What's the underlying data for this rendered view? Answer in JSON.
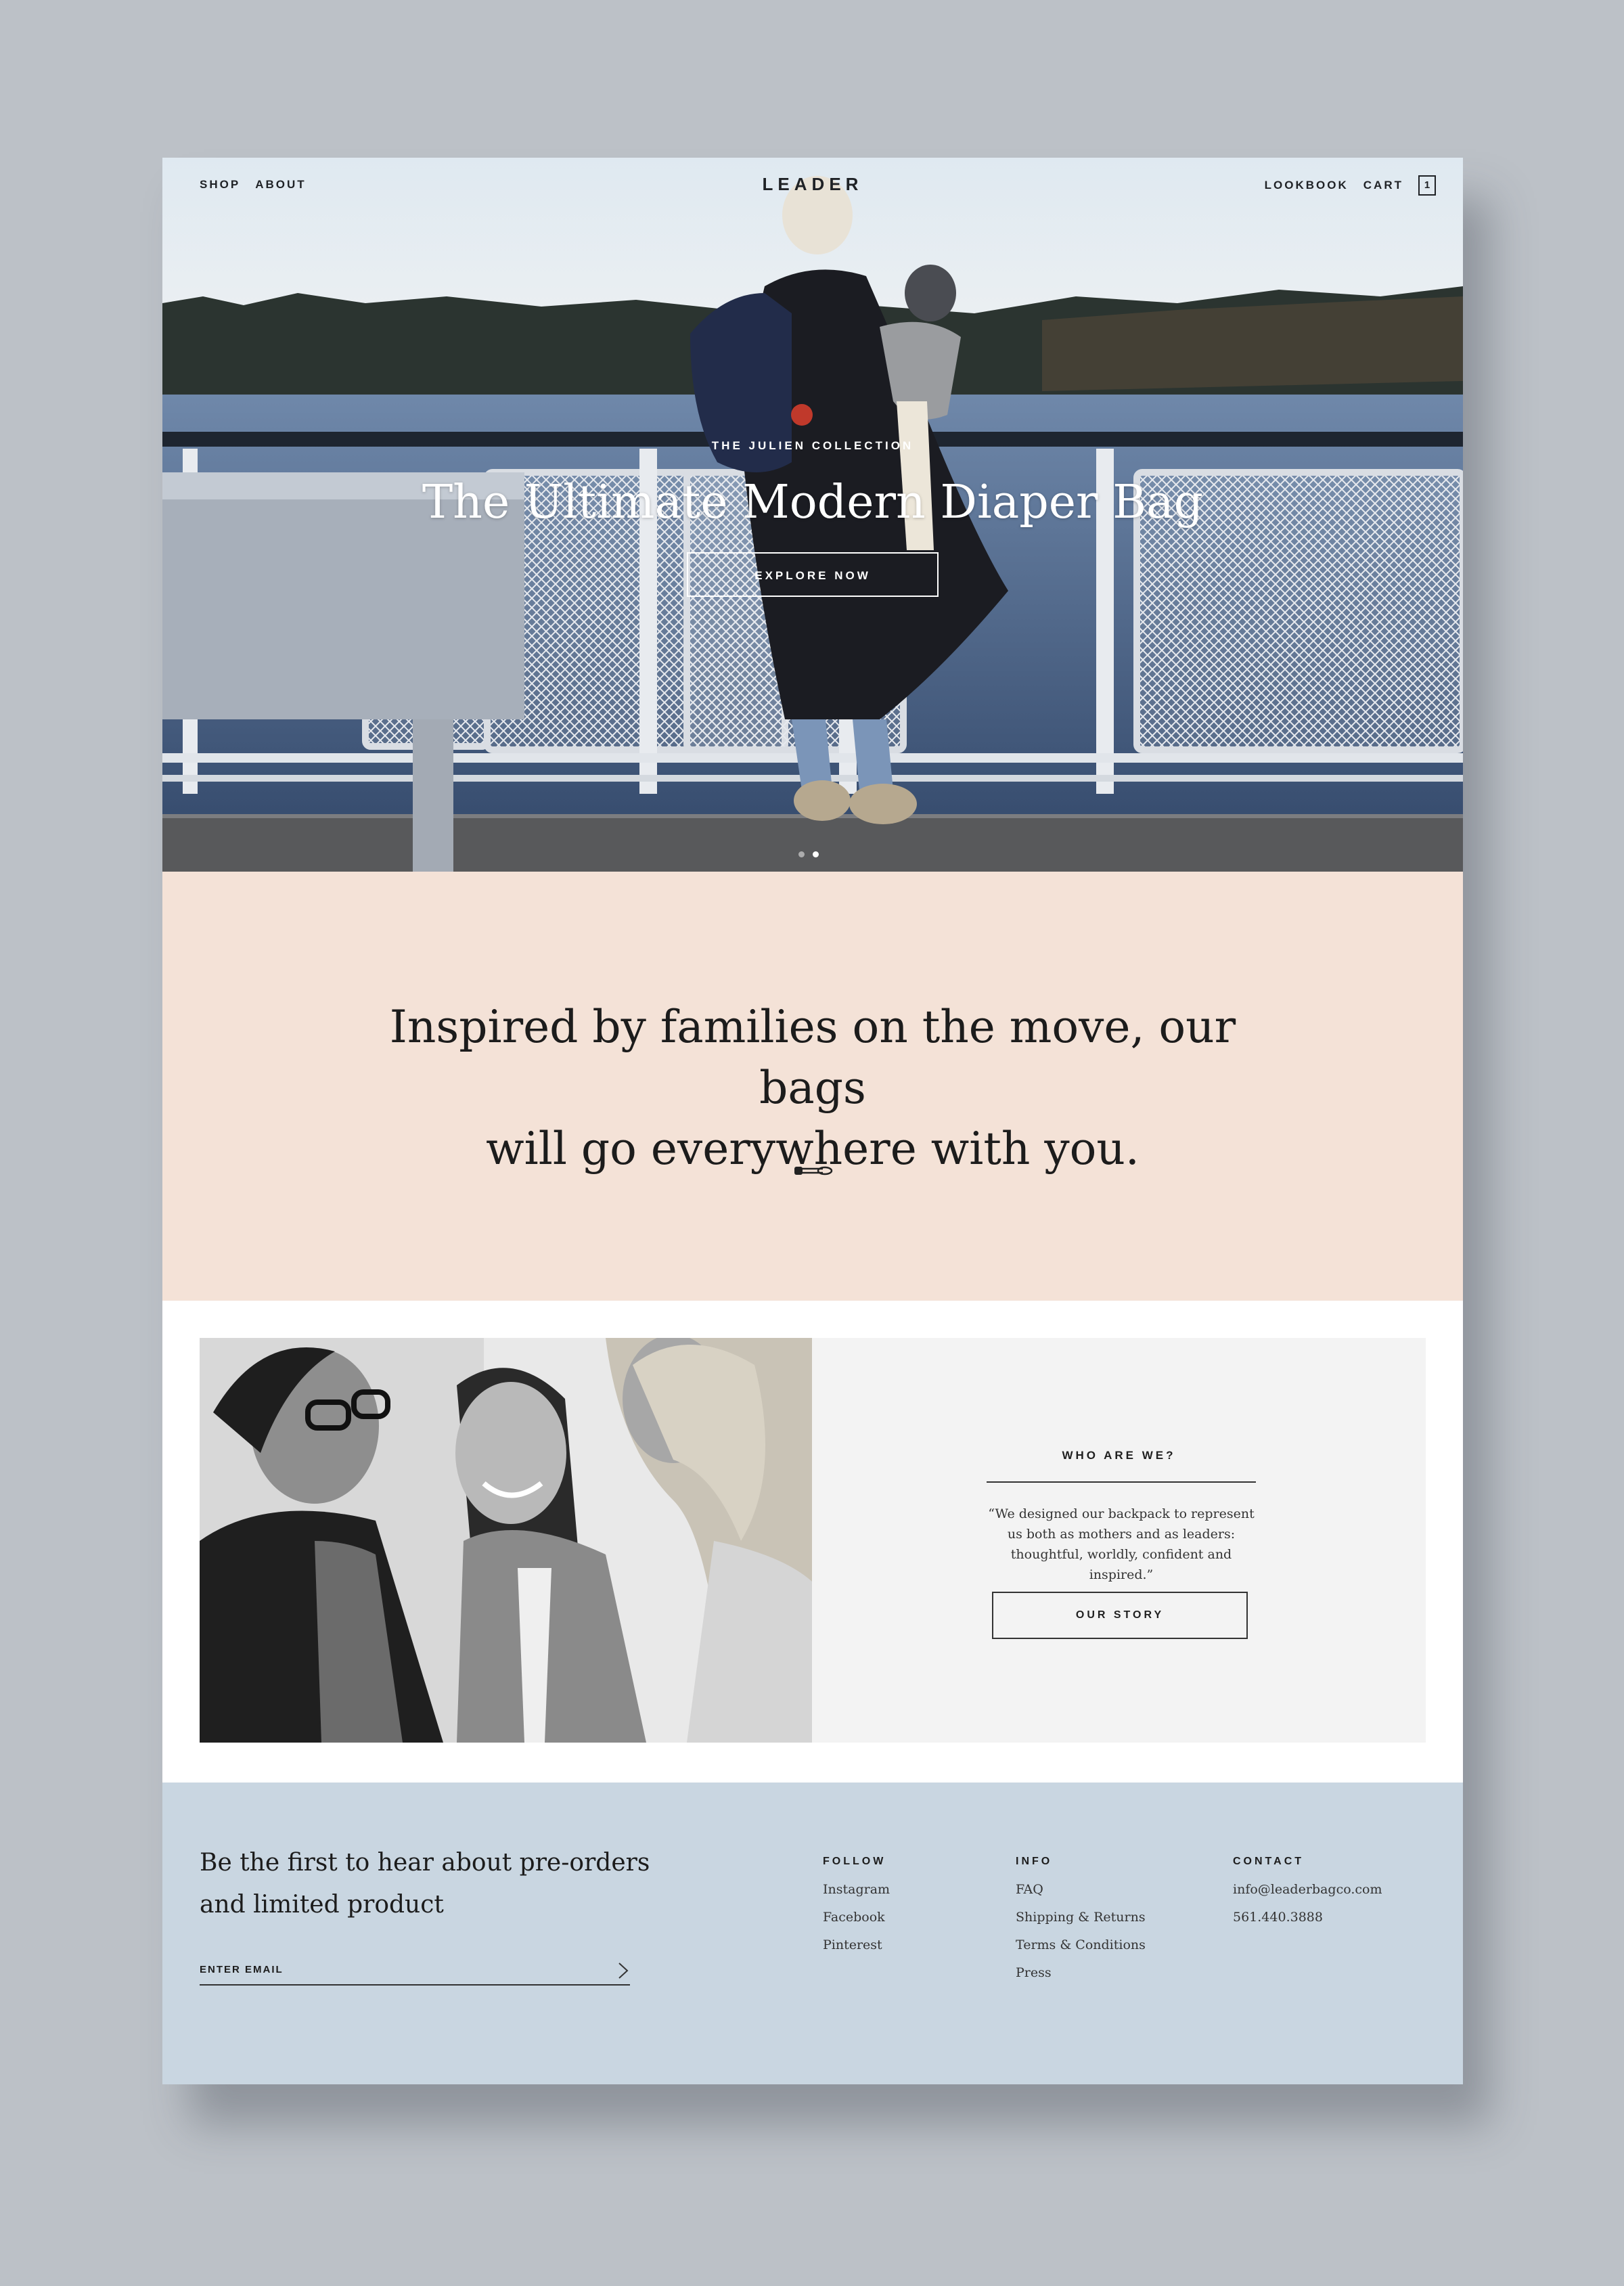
{
  "header": {
    "nav_left": [
      "SHOP",
      "ABOUT"
    ],
    "logo": "LEADER",
    "nav_right": [
      "LOOKBOOK",
      "CART"
    ],
    "cart_count": "1"
  },
  "hero": {
    "eyebrow": "THE JULIEN COLLECTION",
    "title": "The Ultimate Modern Diaper Bag",
    "button": "EXPLORE NOW",
    "slide_count": 2,
    "active_slide": 2
  },
  "tagline": {
    "line1": "Inspired by families on the move, our bags",
    "line2": "will go everywhere with you.",
    "icon": "safety-pin-icon"
  },
  "about": {
    "heading": "WHO ARE WE?",
    "quote": "“We designed our backpack to represent us both as mothers and as leaders: thoughtful, worldly, confident and inspired.”",
    "button": "OUR STORY"
  },
  "footer": {
    "signup_text": "Be the first to hear about pre-orders and limited product",
    "email_placeholder": "ENTER EMAIL",
    "columns": [
      {
        "heading": "FOLLOW",
        "links": [
          "Instagram",
          "Facebook",
          "Pinterest"
        ]
      },
      {
        "heading": "INFO",
        "links": [
          "FAQ",
          "Shipping & Returns",
          "Terms & Conditions",
          "Press"
        ]
      },
      {
        "heading": "CONTACT",
        "links": [
          "info@leaderbagco.com",
          "561.440.3888"
        ]
      }
    ]
  },
  "colors": {
    "background": "#bcc1c7",
    "tagline_bg": "#f4e2d7",
    "footer_bg": "#c9d6e1",
    "panel_bg": "#f3f3f3"
  }
}
